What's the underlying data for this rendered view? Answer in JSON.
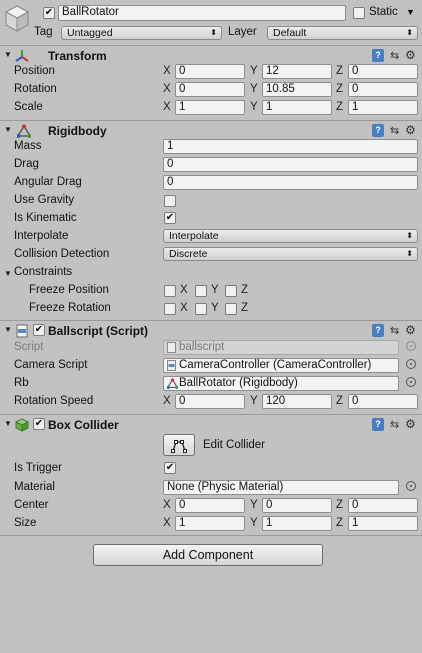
{
  "header": {
    "object_name": "BallRotator",
    "active_checked": "✔",
    "static_label": "Static",
    "static_arrow": "▼",
    "tag_label": "Tag",
    "tag_value": "Untagged",
    "layer_label": "Layer",
    "layer_value": "Default",
    "arrow": "⬍"
  },
  "transform": {
    "title": "Transform",
    "position_label": "Position",
    "rotation_label": "Rotation",
    "scale_label": "Scale",
    "axes": [
      "X",
      "Y",
      "Z"
    ],
    "position": [
      "0",
      "12",
      "0"
    ],
    "rotation": [
      "0",
      "10.85",
      "0"
    ],
    "scale": [
      "1",
      "1",
      "1"
    ]
  },
  "rigidbody": {
    "title": "Rigidbody",
    "mass_label": "Mass",
    "mass": "1",
    "drag_label": "Drag",
    "drag": "0",
    "angular_drag_label": "Angular Drag",
    "angular_drag": "0",
    "use_gravity_label": "Use Gravity",
    "is_kinematic_label": "Is Kinematic",
    "is_kinematic_mark": "✔",
    "interpolate_label": "Interpolate",
    "interpolate": "Interpolate",
    "collision_label": "Collision Detection",
    "collision": "Discrete",
    "constraints_label": "Constraints",
    "freeze_position_label": "Freeze Position",
    "freeze_rotation_label": "Freeze Rotation",
    "axes": [
      "X",
      "Y",
      "Z"
    ]
  },
  "ballscript": {
    "title": "Ballscript (Script)",
    "enabled_mark": "✔",
    "script_label": "Script",
    "script": "ballscript",
    "camera_label": "Camera Script",
    "camera": "CameraController (CameraController)",
    "rb_label": "Rb",
    "rb": "BallRotator (Rigidbody)",
    "rotation_speed_label": "Rotation Speed",
    "axes": [
      "X",
      "Y",
      "Z"
    ],
    "rotation_speed": [
      "0",
      "120",
      "0"
    ]
  },
  "box_collider": {
    "title": "Box Collider",
    "enabled_mark": "✔",
    "edit_label": "Edit Collider",
    "is_trigger_label": "Is Trigger",
    "is_trigger_mark": "✔",
    "material_label": "Material",
    "material": "None (Physic Material)",
    "center_label": "Center",
    "size_label": "Size",
    "axes": [
      "X",
      "Y",
      "Z"
    ],
    "center": [
      "0",
      "0",
      "0"
    ],
    "size": [
      "1",
      "1",
      "1"
    ]
  },
  "footer": {
    "add_component": "Add Component"
  },
  "toolbar": {
    "book": "?",
    "preset": "⇆",
    "gear": "⚙"
  },
  "fold": "▼",
  "colors": {
    "panel": "#c2c2c2",
    "field": "#f3f3f3",
    "help_blue": "#4a7ec2"
  }
}
